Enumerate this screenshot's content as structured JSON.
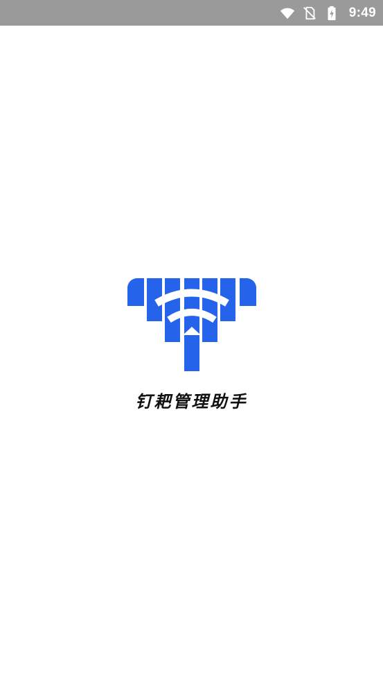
{
  "status_bar": {
    "time": "9:49",
    "icons": [
      "wifi-icon",
      "no-sim-icon",
      "battery-charging-icon"
    ],
    "background": "#9a9a9a",
    "foreground": "#ffffff"
  },
  "splash": {
    "app_name": "钉耙管理助手",
    "logo_icon": "rake-wifi-logo-icon",
    "brand_color": "#2563eb",
    "background": "#ffffff"
  }
}
